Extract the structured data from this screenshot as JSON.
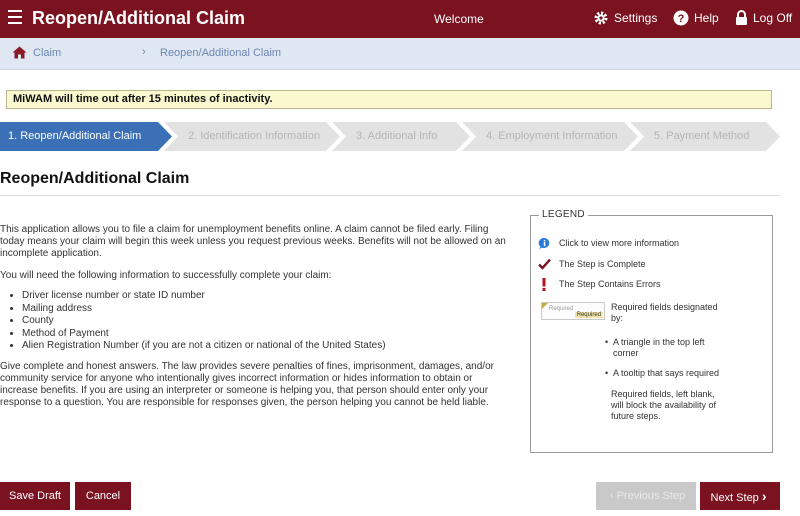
{
  "header": {
    "title": "Reopen/Additional Claim",
    "welcome": "Welcome",
    "settings_label": "Settings",
    "help_label": "Help",
    "logoff_label": "Log Off"
  },
  "breadcrumb": {
    "home_label": "Claim",
    "separator": "›",
    "current": "Reopen/Additional Claim"
  },
  "timeout_notice": "MiWAM will time out after 15 minutes of inactivity.",
  "steps": [
    {
      "label": "1. Reopen/Additional Claim",
      "state": "active"
    },
    {
      "label": "2. Identification Information",
      "state": "inactive"
    },
    {
      "label": "3. Additional Info",
      "state": "inactive"
    },
    {
      "label": "4. Employment Information",
      "state": "inactive"
    },
    {
      "label": "5. Payment Method",
      "state": "inactive"
    }
  ],
  "page": {
    "title": "Reopen/Additional Claim",
    "intro": "This application allows you to file a claim for unemployment benefits online. A claim cannot be filed early. Filing today means your claim will begin this week unless you request previous weeks. Benefits will not be allowed on an incomplete application.",
    "need_info": "You will need the following information to successfully complete your claim:",
    "requirements": [
      "Driver license number or state ID number",
      "Mailing address",
      "County",
      "Method of Payment",
      "Alien Registration Number (if you are not a citizen or national of the United States)"
    ],
    "warning": "Give complete and honest answers. The law provides severe penalties of fines, imprisonment, damages, and/or community service for anyone who intentionally gives incorrect information or hides information to obtain or increase benefits. If you are using an interpreter or someone is helping you, that person should enter only your response to a question. You are responsible for responses given, the person helping you cannot be held liable."
  },
  "legend": {
    "title": "LEGEND",
    "info": "Click to view more information",
    "complete": "The Step is Complete",
    "errors": "The Step Contains Errors",
    "sample_placeholder": "Required",
    "sample_tip": "Required",
    "required_desc": "Required fields designated by:",
    "bullet_triangle": "A triangle in the top left corner",
    "bullet_tooltip": "A tooltip that says required",
    "blank_note": "Required fields, left blank, will block the availability of future steps."
  },
  "buttons": {
    "save_draft": "Save Draft",
    "cancel": "Cancel",
    "previous": "Previous Step",
    "next": "Next Step"
  },
  "colors": {
    "brand": "#7a1220",
    "active_step": "#3b6fb6",
    "breadcrumb_bg": "#dfe7f3",
    "notice_bg": "#fbf8d0"
  }
}
